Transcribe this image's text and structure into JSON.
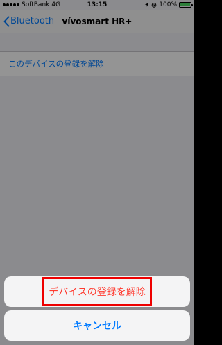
{
  "status_bar": {
    "carrier": "SoftBank",
    "network": "4G",
    "time": "13:15",
    "battery": "100%",
    "battery_level": 1.0
  },
  "nav": {
    "back_label": "Bluetooth",
    "title": "vívosmart HR+"
  },
  "list": {
    "items": [
      {
        "label": "このデバイスの登録を解除"
      }
    ]
  },
  "action_sheet": {
    "destructive_label": "デバイスの登録を解除",
    "cancel_label": "キャンセル"
  },
  "colors": {
    "accent": "#007aff",
    "destructive": "#ff3b30",
    "highlight": "#ee0000",
    "battery": "#4cd964"
  },
  "icons": [
    "chevron-left-icon",
    "location-arrow-icon",
    "alarm-icon",
    "battery-icon",
    "signal-dots-icon"
  ]
}
